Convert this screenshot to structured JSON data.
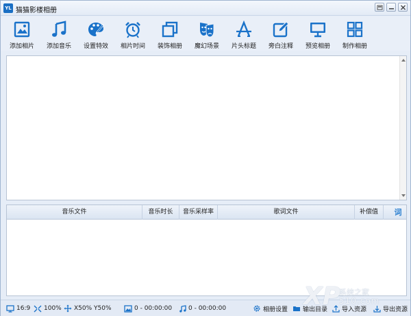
{
  "window": {
    "logo": "YL",
    "title": "猫猫影楼相册"
  },
  "toolbar": {
    "items": [
      {
        "label": "添加相片",
        "icon": "image-icon"
      },
      {
        "label": "添加音乐",
        "icon": "music-note-icon"
      },
      {
        "label": "设置特效",
        "icon": "palette-icon"
      },
      {
        "label": "相片时间",
        "icon": "alarm-clock-icon"
      },
      {
        "label": "装饰相册",
        "icon": "layers-icon"
      },
      {
        "label": "魔幻场景",
        "icon": "mask-icon"
      },
      {
        "label": "片头标题",
        "icon": "title-a-icon"
      },
      {
        "label": "旁白注释",
        "icon": "edit-note-icon"
      },
      {
        "label": "预览相册",
        "icon": "monitor-icon"
      },
      {
        "label": "制作相册",
        "icon": "grid-icon"
      }
    ],
    "icon_color": "#1a72c9"
  },
  "music_table": {
    "columns": [
      "音乐文件",
      "音乐时长",
      "音乐采样率",
      "歌词文件",
      "补偿值"
    ],
    "lyric_button": "词"
  },
  "status": {
    "aspect": "16:9",
    "zoom": "100%",
    "position": "X50% Y50%",
    "photo_count": "0 - 00:00:00",
    "music_count": "0 - 00:00:00",
    "album_settings": "相册设置",
    "output_dir": "输出目录",
    "import": "导入资源",
    "export": "导出资源"
  },
  "watermark": {
    "text": "系统之家",
    "url": "510.com"
  }
}
